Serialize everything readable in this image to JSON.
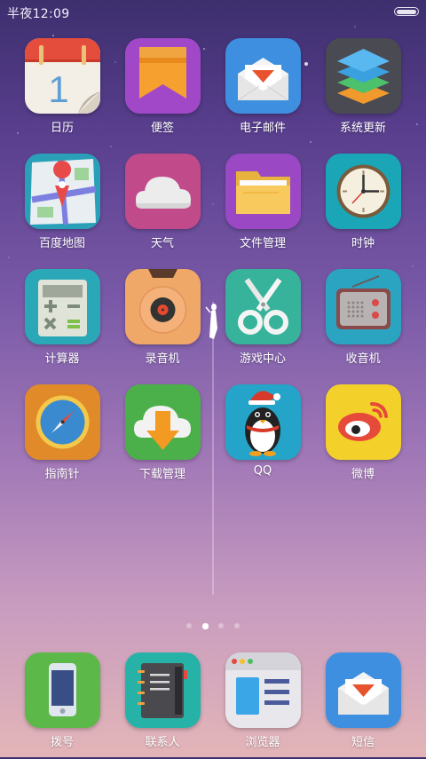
{
  "status": {
    "time": "半夜12:09"
  },
  "apps": [
    {
      "label": "日历",
      "icon": "calendar-icon",
      "day": "1"
    },
    {
      "label": "便签",
      "icon": "notes-icon"
    },
    {
      "label": "电子邮件",
      "icon": "email-icon"
    },
    {
      "label": "系统更新",
      "icon": "system-update-icon"
    },
    {
      "label": "百度地图",
      "icon": "map-icon"
    },
    {
      "label": "天气",
      "icon": "weather-icon"
    },
    {
      "label": "文件管理",
      "icon": "folder-icon"
    },
    {
      "label": "时钟",
      "icon": "clock-icon"
    },
    {
      "label": "计算器",
      "icon": "calculator-icon"
    },
    {
      "label": "录音机",
      "icon": "recorder-icon"
    },
    {
      "label": "游戏中心",
      "icon": "game-center-icon"
    },
    {
      "label": "收音机",
      "icon": "radio-icon"
    },
    {
      "label": "指南针",
      "icon": "compass-icon"
    },
    {
      "label": "下载管理",
      "icon": "download-icon"
    },
    {
      "label": "QQ",
      "icon": "qq-penguin-icon"
    },
    {
      "label": "微博",
      "icon": "weibo-icon"
    }
  ],
  "dock": [
    {
      "label": "拨号",
      "icon": "phone-icon"
    },
    {
      "label": "联系人",
      "icon": "contacts-icon"
    },
    {
      "label": "浏览器",
      "icon": "browser-icon"
    },
    {
      "label": "短信",
      "icon": "sms-icon"
    }
  ],
  "pages": {
    "count": 4,
    "active": 1
  }
}
